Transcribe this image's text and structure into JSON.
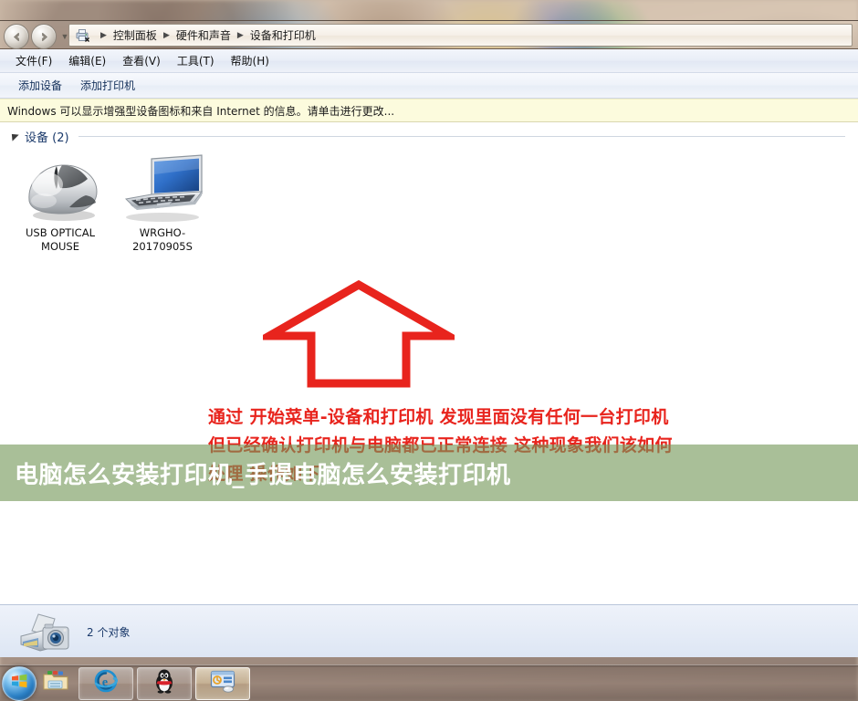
{
  "window": {
    "address": {
      "icon": "devices-printers-icon",
      "crumbs": [
        "控制面板",
        "硬件和声音",
        "设备和打印机"
      ],
      "separator": "▶",
      "back_icon": "back-arrow-icon",
      "forward_icon": "forward-arrow-icon",
      "history_icon": "chevron-down-icon"
    },
    "menubar": [
      "文件(F)",
      "编辑(E)",
      "查看(V)",
      "工具(T)",
      "帮助(H)"
    ],
    "toolbar": [
      "添加设备",
      "添加打印机"
    ],
    "infobar": {
      "text": "Windows 可以显示增强型设备图标和来自 Internet 的信息。请单击进行更改..."
    },
    "group": {
      "title": "设备 (2)",
      "collapse_icon": "triangle-collapse-icon"
    },
    "devices": [
      {
        "label": "USB OPTICAL MOUSE",
        "icon": "mouse-icon"
      },
      {
        "label": "WRGHO-20170905S",
        "icon": "laptop-computer-icon"
      }
    ],
    "status": {
      "icon": "printer-camera-icon",
      "text": "2 个对象"
    }
  },
  "annotation": {
    "arrow_icon": "red-up-arrow-annotation",
    "color": "#e8241d",
    "lines": [
      "通过 开始菜单-设备和打印机 发现里面没有任何一台打印机",
      "但已经确认打印机与电脑都已正常连接  这种现象我们该如何",
      "处理 操作如下"
    ]
  },
  "overlay": {
    "title": "电脑怎么安装打印机_手提电脑怎么安装打印机",
    "band_color": "#749858",
    "text_color": "#ffffff"
  },
  "taskbar": {
    "start_icon": "windows-start-orb-icon",
    "quicklaunch": [
      {
        "name": "explorer-folder-icon",
        "label": "Windows 资源管理器"
      }
    ],
    "buttons": [
      {
        "name": "internet-explorer-icon",
        "label": "Internet Explorer",
        "active": false
      },
      {
        "name": "qq-penguin-icon",
        "label": "QQ",
        "active": false
      },
      {
        "name": "devices-printers-window-icon",
        "label": "设备和打印机",
        "active": true
      }
    ]
  }
}
